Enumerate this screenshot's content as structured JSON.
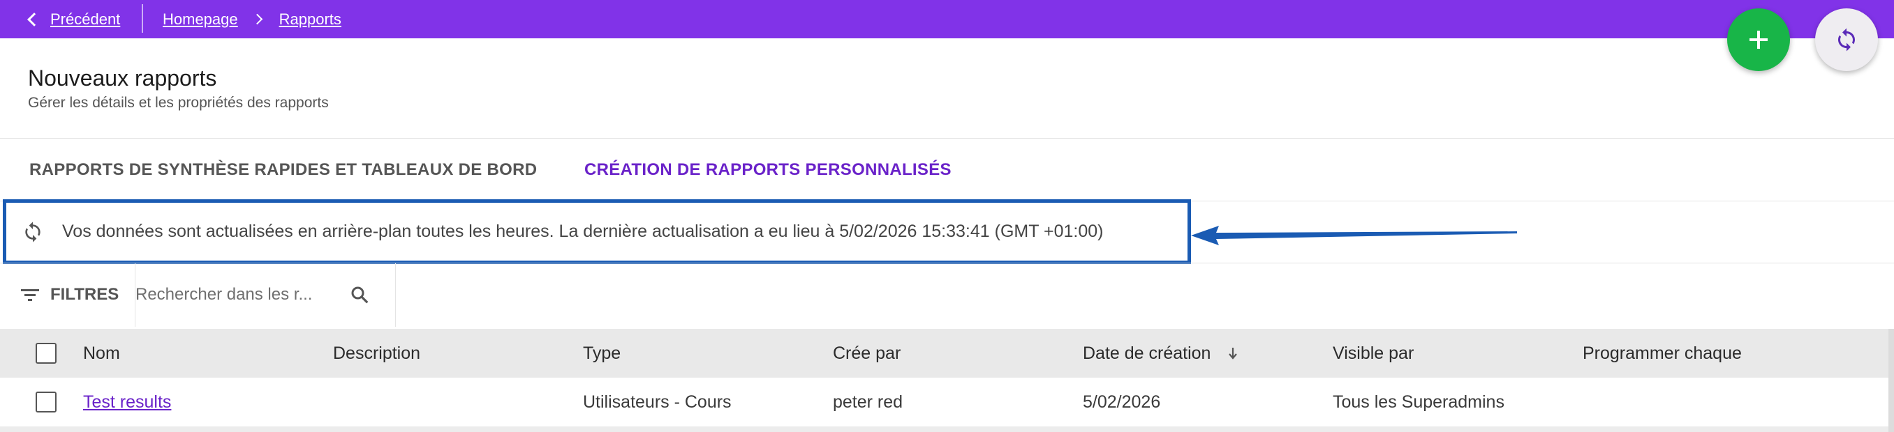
{
  "topbar": {
    "back_label": "Précédent",
    "breadcrumbs": [
      "Homepage",
      "Rapports"
    ],
    "color": "#8133e8"
  },
  "actions": {
    "add_icon": "plus-icon",
    "sync_icon": "sync-icon",
    "add_color": "#18b548"
  },
  "header": {
    "title": "Nouveaux rapports",
    "subtitle": "Gérer les détails et les propriétés des rapports"
  },
  "tabs": [
    {
      "label": "RAPPORTS DE SYNTHÈSE RAPIDES ET TABLEAUX DE BORD",
      "active": false
    },
    {
      "label": "CRÉATION DE RAPPORTS PERSONNALISÉS",
      "active": true
    }
  ],
  "notice": {
    "icon": "sync-icon",
    "message": "Vos données sont actualisées en arrière-plan toutes les heures. La dernière actualisation a eu lieu à 5/02/2026 15:33:41 (GMT +01:00)",
    "highlight_color": "#1a5bb3"
  },
  "toolbar": {
    "filters_label": "FILTRES",
    "search_placeholder": "Rechercher dans les r..."
  },
  "table": {
    "columns": [
      "Nom",
      "Description",
      "Type",
      "Crée par",
      "Date de création",
      "Visible par",
      "Programmer chaque"
    ],
    "sorted_column": "Date de création",
    "rows": [
      {
        "nom": "Test results",
        "description": "",
        "type": "Utilisateurs - Cours",
        "cree_par": "peter red",
        "date_creation": "5/02/2026",
        "visible_par": "Tous les Superadmins",
        "programmer": ""
      }
    ]
  }
}
